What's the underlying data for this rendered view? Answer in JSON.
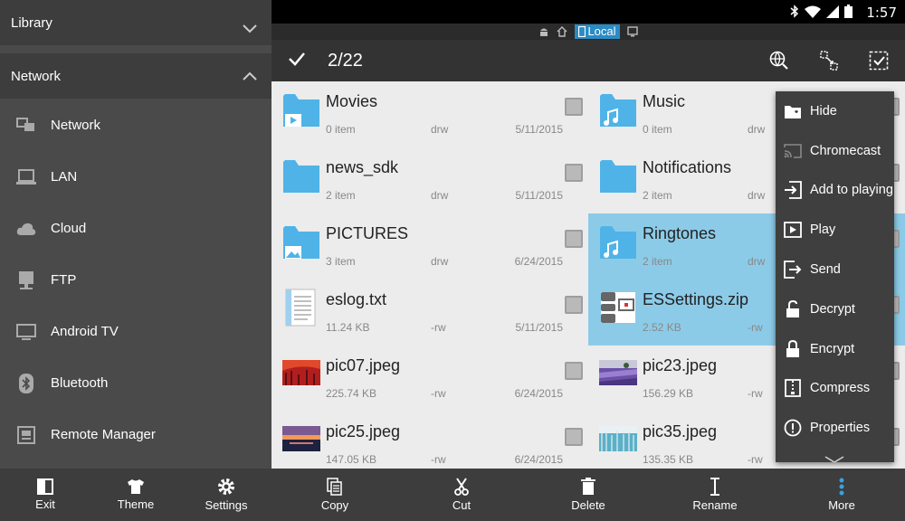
{
  "status": {
    "time": "1:57"
  },
  "sidebar": {
    "library_label": "Library",
    "network_label": "Network",
    "items": [
      {
        "label": "Network",
        "icon": "network-icon"
      },
      {
        "label": "LAN",
        "icon": "computer-icon"
      },
      {
        "label": "Cloud",
        "icon": "cloud-icon"
      },
      {
        "label": "FTP",
        "icon": "ftp-icon"
      },
      {
        "label": "Android TV",
        "icon": "tv-icon"
      },
      {
        "label": "Bluetooth",
        "icon": "bluetooth-icon"
      },
      {
        "label": "Remote Manager",
        "icon": "remote-icon"
      }
    ],
    "bottom": {
      "exit": "Exit",
      "theme": "Theme",
      "settings": "Settings"
    }
  },
  "nav": {
    "location": "Local"
  },
  "topbar": {
    "selection_count": "2/22"
  },
  "files": [
    {
      "name": "Movies",
      "count": "0 item",
      "perm": "drw",
      "date": "5/11/2015",
      "type": "folder-video",
      "selected": false
    },
    {
      "name": "Music",
      "count": "0 item",
      "perm": "drw",
      "date": "",
      "type": "folder-music",
      "selected": false
    },
    {
      "name": "news_sdk",
      "count": "2 item",
      "perm": "drw",
      "date": "5/11/2015",
      "type": "folder",
      "selected": false
    },
    {
      "name": "Notifications",
      "count": "2 item",
      "perm": "drw",
      "date": "",
      "type": "folder",
      "selected": false
    },
    {
      "name": "PICTURES",
      "count": "3 item",
      "perm": "drw",
      "date": "6/24/2015",
      "type": "folder-picture",
      "selected": false
    },
    {
      "name": "Ringtones",
      "count": "2 item",
      "perm": "drw",
      "date": "",
      "type": "folder-music",
      "selected": true
    },
    {
      "name": "eslog.txt",
      "count": "11.24 KB",
      "perm": "-rw",
      "date": "5/11/2015",
      "type": "text",
      "selected": false
    },
    {
      "name": "ESSettings.zip",
      "count": "2.52 KB",
      "perm": "-rw",
      "date": "",
      "type": "zip",
      "selected": true
    },
    {
      "name": "pic07.jpeg",
      "count": "225.74 KB",
      "perm": "-rw",
      "date": "6/24/2015",
      "type": "img-red",
      "selected": false
    },
    {
      "name": "pic23.jpeg",
      "count": "156.29 KB",
      "perm": "-rw",
      "date": "",
      "type": "img-purple",
      "selected": false
    },
    {
      "name": "pic25.jpeg",
      "count": "147.05 KB",
      "perm": "-rw",
      "date": "6/24/2015",
      "type": "img-sunset",
      "selected": false
    },
    {
      "name": "pic35.jpeg",
      "count": "135.35 KB",
      "perm": "-rw",
      "date": "",
      "type": "img-lake",
      "selected": false
    }
  ],
  "bottom": {
    "copy": "Copy",
    "cut": "Cut",
    "delete": "Delete",
    "rename": "Rename",
    "more": "More"
  },
  "menu": [
    {
      "label": "Hide",
      "icon": "hide-icon"
    },
    {
      "label": "Chromecast",
      "icon": "chromecast-icon"
    },
    {
      "label": "Add to playing",
      "icon": "add-to-playing-icon"
    },
    {
      "label": "Play",
      "icon": "play-icon"
    },
    {
      "label": "Send",
      "icon": "send-icon"
    },
    {
      "label": "Decrypt",
      "icon": "unlock-icon"
    },
    {
      "label": "Encrypt",
      "icon": "lock-icon"
    },
    {
      "label": "Compress",
      "icon": "compress-icon"
    },
    {
      "label": "Properties",
      "icon": "info-icon"
    }
  ],
  "colors": {
    "selection": "#8ccbe8",
    "folder": "#4fb3e8",
    "accent": "#2b8bc4",
    "more_accent": "#3aa0e0"
  }
}
